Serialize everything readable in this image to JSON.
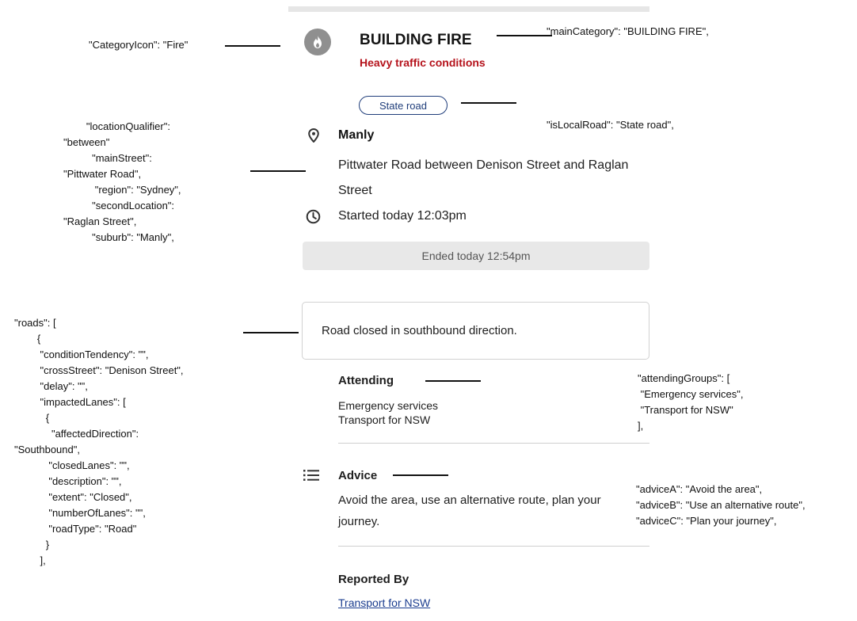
{
  "card": {
    "title": "BUILDING FIRE",
    "subtitle": "Heavy traffic conditions",
    "road_badge": "State road",
    "suburb": "Manly",
    "location_desc": "Pittwater Road between Denison Street and Raglan Street",
    "started": "Started today 12:03pm",
    "ended": "Ended today 12:54pm",
    "road_status": "Road closed in southbound direction.",
    "attending_title": "Attending",
    "attending": [
      "Emergency services",
      "Transport for NSW"
    ],
    "advice_title": "Advice",
    "advice_text": "Avoid the area, use an alternative route, plan your journey.",
    "reported_title": "Reported By",
    "reported_link": "Transport for NSW",
    "icons": {
      "category": "fire-icon",
      "location": "map-pin-icon",
      "time": "clock-icon",
      "advice": "list-icon"
    },
    "colors": {
      "subtitle": "#b5121b",
      "link": "#1a3c8f",
      "badge": "#1f3d7a",
      "icon_bg": "#8f8f8f"
    }
  },
  "annotations": {
    "category_icon": "\"CategoryIcon\": \"Fire\"",
    "main_category": "\"mainCategory\": \"BUILDING FIRE\",",
    "is_local_road": "\"isLocalRoad\": \"State road\",",
    "location": "        \"locationQualifier\":\n\"between\"\n          \"mainStreet\":\n\"Pittwater Road\",\n           \"region\": \"Sydney\",\n          \"secondLocation\":\n\"Raglan Street\",\n          \"suburb\": \"Manly\",",
    "roads": "\"roads\": [\n        {\n         \"conditionTendency\": \"\",\n         \"crossStreet\": \"Denison Street\",\n         \"delay\": \"\",\n         \"impactedLanes\": [\n           {\n             \"affectedDirection\":\n\"Southbound\",\n            \"closedLanes\": \"\",\n            \"description\": \"\",\n            \"extent\": \"Closed\",\n            \"numberOfLanes\": \"\",\n            \"roadType\": \"Road\"\n           }\n         ],",
    "attending": "\"attendingGroups\": [\n \"Emergency services\",\n \"Transport for NSW\"\n],",
    "advice": "\"adviceA\": \"Avoid the area\",\n\"adviceB\": \"Use an alternative route\",\n\"adviceC\": \"Plan your journey\","
  }
}
